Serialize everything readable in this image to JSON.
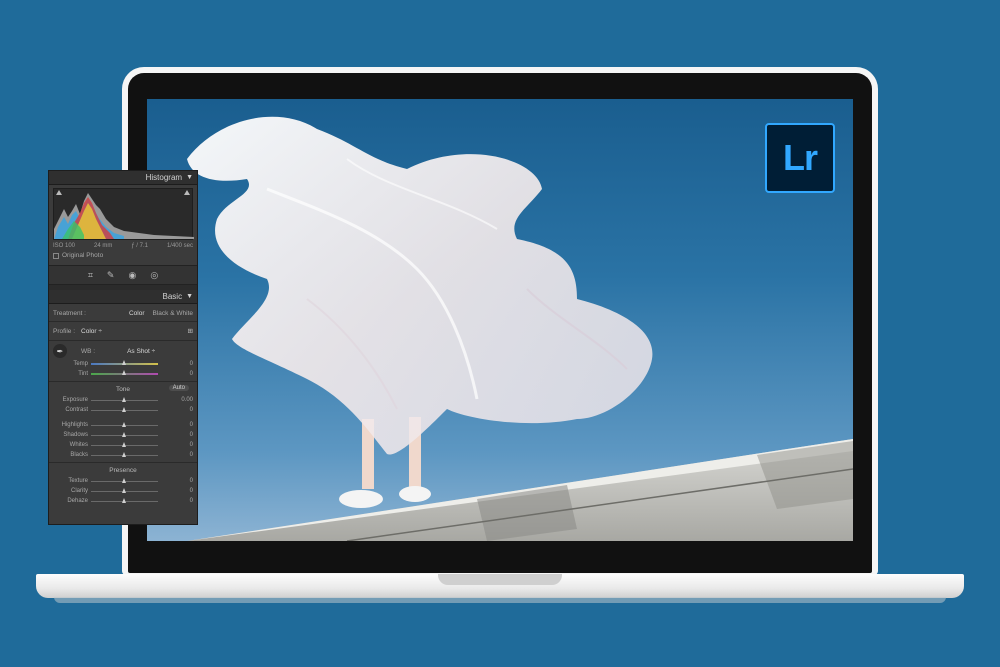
{
  "logo": {
    "text": "Lr"
  },
  "panel": {
    "histogram": {
      "header": "Histogram",
      "iso": "ISO 100",
      "focal": "24 mm",
      "aperture": "ƒ / 7.1",
      "shutter": "1/400 sec",
      "original_photo_label": "Original Photo"
    },
    "basic": {
      "header": "Basic",
      "treatment_label": "Treatment :",
      "treatment_color": "Color",
      "treatment_bw": "Black & White",
      "profile_label": "Profile :",
      "profile_value": "Color ÷",
      "wb_label": "WB :",
      "wb_value": "As Shot ÷",
      "temp": {
        "label": "Temp",
        "value": "0",
        "level": 0.5
      },
      "tint": {
        "label": "Tint",
        "value": "0",
        "level": 0.5
      },
      "tone_title": "Tone",
      "auto_label": "Auto",
      "exposure": {
        "label": "Exposure",
        "value": "0.00",
        "level": 0.5
      },
      "contrast": {
        "label": "Contrast",
        "value": "0",
        "level": 0.5
      },
      "highlights": {
        "label": "Highlights",
        "value": "0",
        "level": 0.5
      },
      "shadows": {
        "label": "Shadows",
        "value": "0",
        "level": 0.5
      },
      "whites": {
        "label": "Whites",
        "value": "0",
        "level": 0.5
      },
      "blacks": {
        "label": "Blacks",
        "value": "0",
        "level": 0.5
      },
      "presence_title": "Presence",
      "texture": {
        "label": "Texture",
        "value": "0",
        "level": 0.5
      },
      "clarity": {
        "label": "Clarity",
        "value": "0",
        "level": 0.5
      },
      "dehaze": {
        "label": "Dehaze",
        "value": "0",
        "level": 0.5
      }
    }
  },
  "colors": {
    "background": "#1f6b9a",
    "lr_blue": "#31a8ff",
    "lr_navy": "#001e36"
  }
}
